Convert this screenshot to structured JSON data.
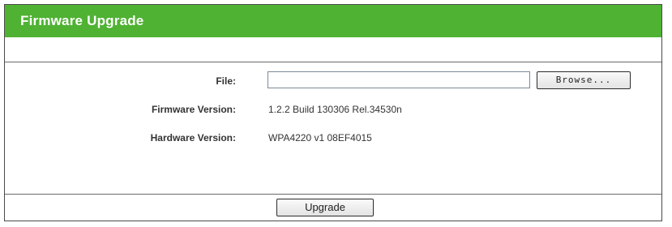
{
  "header": {
    "title": "Firmware Upgrade"
  },
  "form": {
    "file_label": "File:",
    "file_value": "",
    "browse_label": "Browse...",
    "firmware_label": "Firmware Version:",
    "firmware_value": "1.2.2 Build 130306 Rel.34530n",
    "hardware_label": "Hardware Version:",
    "hardware_value": "WPA4220 v1 08EF4015"
  },
  "actions": {
    "upgrade_label": "Upgrade"
  },
  "colors": {
    "header_bg": "#4fb233",
    "header_text": "#ffffff"
  }
}
